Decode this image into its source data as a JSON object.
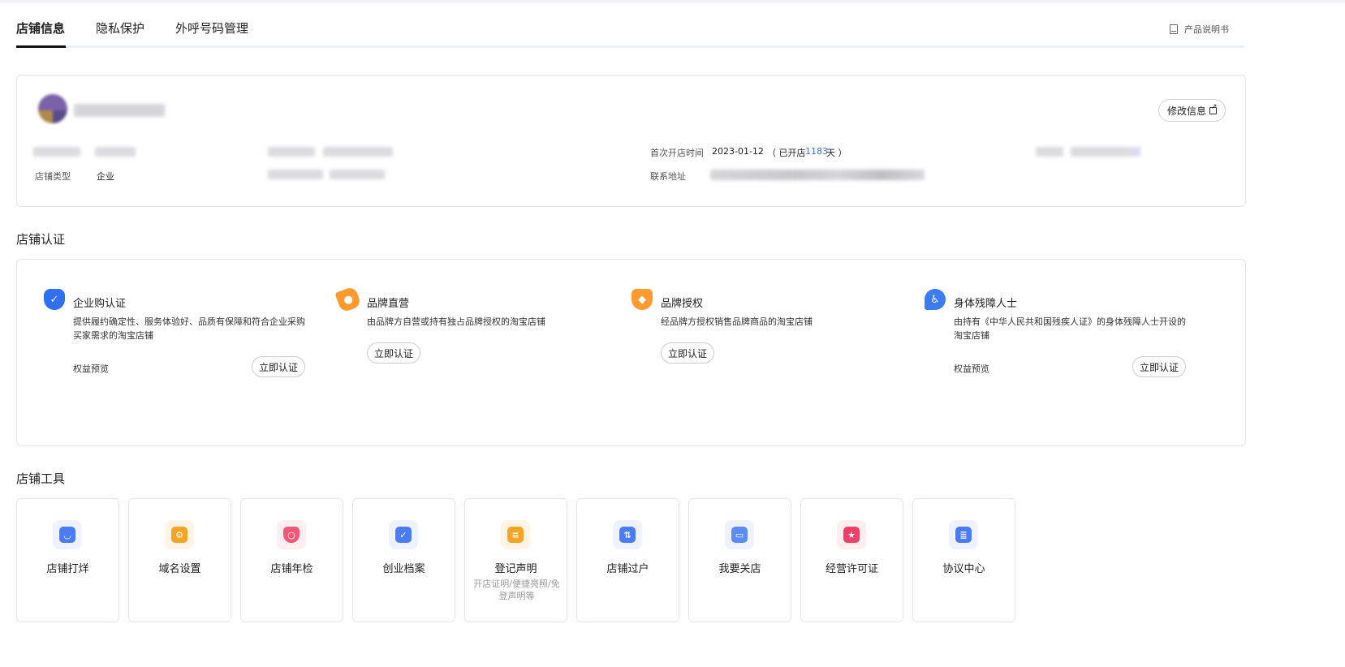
{
  "tabs": [
    {
      "label": "店铺信息"
    },
    {
      "label": "隐私保护"
    },
    {
      "label": "外呼号码管理"
    }
  ],
  "manual_label": "产品说明书",
  "store_info": {
    "edit_label": "修改信息",
    "first_open_label": "首次开店时间",
    "first_open_date": "2023-01-12",
    "open_prefix": "（ 已开店",
    "open_days": "1183",
    "open_suffix": "天 ）",
    "store_type_label": "店铺类型",
    "store_type_value": "企业",
    "address_label": "联系地址"
  },
  "cert_section": {
    "title": "店铺认证",
    "items": [
      {
        "icon": "shield-check-icon",
        "title": "企业购认证",
        "desc": "提供履约确定性、服务体验好、品质有保障和符合企业采购买家需求的淘宝店铺",
        "link": "权益预览",
        "button": "立即认证",
        "color": "#2f6ff2"
      },
      {
        "icon": "tag-icon",
        "title": "品牌直营",
        "desc": "由品牌方自营或持有独占品牌授权的淘宝店铺",
        "link": "",
        "button": "立即认证",
        "color": "#ff9a2e"
      },
      {
        "icon": "diamond-icon",
        "title": "品牌授权",
        "desc": "经品牌方授权销售品牌商品的淘宝店铺",
        "link": "",
        "button": "立即认证",
        "color": "#ff9a2e"
      },
      {
        "icon": "heart-wheelchair-icon",
        "title": "身体残障人士",
        "desc": "由持有《中华人民共和国残疾人证》的身体残障人士开设的淘宝店铺",
        "link": "权益预览",
        "button": "立即认证",
        "color": "#3b7cf5"
      }
    ]
  },
  "tools_section": {
    "title": "店铺工具",
    "items": [
      {
        "name": "店铺打烊",
        "sub": "",
        "icon": "shop-close-icon",
        "bg": "#eef3ff",
        "color": "#4a7cf7"
      },
      {
        "name": "域名设置",
        "sub": "",
        "icon": "domain-icon",
        "bg": "#fff4e6",
        "color": "#f5a425"
      },
      {
        "name": "店铺年检",
        "sub": "",
        "icon": "inspection-shield-icon",
        "bg": "#ffeef0",
        "color": "#f0587a"
      },
      {
        "name": "创业档案",
        "sub": "",
        "icon": "archive-icon",
        "bg": "#eef3ff",
        "color": "#4a7cf7"
      },
      {
        "name": "登记声明",
        "sub": "开店证明/便捷亮照/免登声明等",
        "icon": "register-doc-icon",
        "bg": "#fff4e6",
        "color": "#f5a425"
      },
      {
        "name": "店铺过户",
        "sub": "",
        "icon": "transfer-icon",
        "bg": "#eef3ff",
        "color": "#4a7cf7"
      },
      {
        "name": "我要关店",
        "sub": "",
        "icon": "close-store-icon",
        "bg": "#eef3ff",
        "color": "#5b8cf7"
      },
      {
        "name": "经营许可证",
        "sub": "",
        "icon": "license-folder-icon",
        "bg": "#ffeef0",
        "color": "#f0406a"
      },
      {
        "name": "协议中心",
        "sub": "",
        "icon": "agreement-icon",
        "bg": "#eef3ff",
        "color": "#4a7cf7"
      }
    ]
  }
}
